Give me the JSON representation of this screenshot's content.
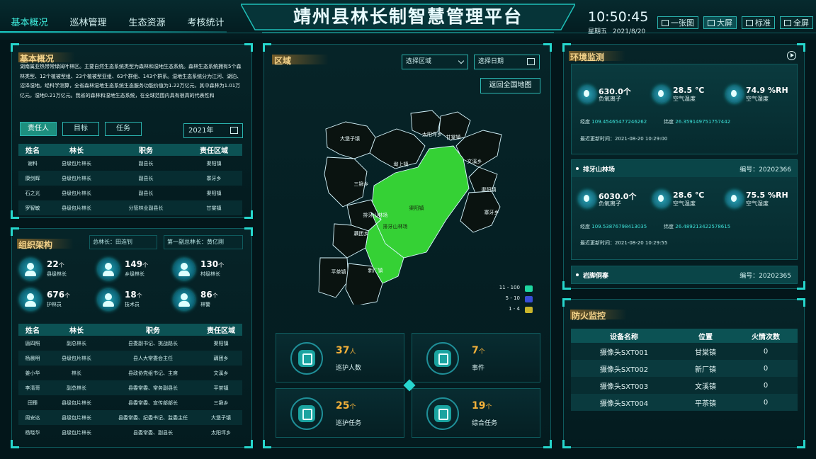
{
  "nav": [
    "基本概况",
    "巡林管理",
    "生态资源",
    "考核统计"
  ],
  "title": "靖州县林长制智慧管理平台",
  "clock": {
    "time": "10:50:45",
    "weekday": "星期五",
    "date": "2021/8/20"
  },
  "mode_buttons": [
    "一张图",
    "大屏",
    "标准",
    "全屏"
  ],
  "overview": {
    "title": "基本概况",
    "intro": "湖南属亚热带常绿阔叶林区。主要自然生态系统类型为森林和湿地生态系统。森林生态系统拥有5个森林类型、12个植被型组、23个植被型亚组、63个群组、143个群系。湿地生态系统分为江河、湖泊、沼泽湿地。经科学测算，全省森林湿地生态系统生态服务功能价值为1.22万亿元，其中森林为1.01万亿元，湿地0.21万亿元。我省的森林和湿地生态系统，在全球范围内具有很高的代表性和",
    "tabs": [
      "责任人",
      "目标",
      "任务"
    ],
    "year": "2021年",
    "headers": [
      "姓名",
      "林长",
      "职务",
      "责任区域"
    ],
    "rows": [
      [
        "谢科",
        "县级包片林长",
        "副县长",
        "渠阳镇"
      ],
      [
        "康剑辉",
        "县级包片林长",
        "副县长",
        "寨牙乡"
      ],
      [
        "石之光",
        "县级包片林长",
        "副县长",
        "渠阳镇"
      ],
      [
        "罗智敏",
        "县级包片林长",
        "分管林业副县长",
        "甘棠镇"
      ]
    ]
  },
  "org": {
    "title": "组织架构",
    "chief": "总林长：田连钊",
    "vice_chief": "第一副总林长：黄亿刚",
    "stats": [
      {
        "num": "22",
        "unit": "个",
        "label": "县级林长"
      },
      {
        "num": "149",
        "unit": "个",
        "label": "乡级林长"
      },
      {
        "num": "130",
        "unit": "个",
        "label": "村级林长"
      },
      {
        "num": "676",
        "unit": "个",
        "label": "护林员"
      },
      {
        "num": "18",
        "unit": "个",
        "label": "技术员"
      },
      {
        "num": "86",
        "unit": "个",
        "label": "林警"
      }
    ],
    "headers": [
      "姓名",
      "林长",
      "职务",
      "责任区域"
    ],
    "rows": [
      [
        "唐四照",
        "副总林长",
        "县委副书记、挑战路长",
        "渠阳镇"
      ],
      [
        "杨晨明",
        "县级包片林长",
        "县人大常委会主任",
        "藕团乡"
      ],
      [
        "姜小华",
        "林长",
        "县政协党组书记、主席",
        "文溪乡"
      ],
      [
        "李清哥",
        "副总林长",
        "县委常委、常务副县长",
        "平茶镇"
      ],
      [
        "田臻",
        "县级包片林长",
        "县委常委、宣传部部长",
        "三锹乡"
      ],
      [
        "周安达",
        "县级包片林长",
        "县委常委、纪委书记、监委主任",
        "大堡子镇"
      ],
      [
        "杨晓华",
        "县级包片林长",
        "县委常委、副县长",
        "太阳坪乡"
      ]
    ]
  },
  "map": {
    "title": "区域",
    "region_select": "选择区域",
    "date_select": "选择日期",
    "back_label": "返回全国地图",
    "regions": [
      {
        "name": "大堡子镇",
        "level": "low"
      },
      {
        "name": "太阳坪乡",
        "level": "low"
      },
      {
        "name": "甘棠镇",
        "level": "low"
      },
      {
        "name": "坳上镇",
        "level": "low"
      },
      {
        "name": "文溪乡",
        "level": "low"
      },
      {
        "name": "三锹乡",
        "level": "low"
      },
      {
        "name": "渠阳镇",
        "level": "high"
      },
      {
        "name": "渠阳镇",
        "level": "low"
      },
      {
        "name": "寨牙乡",
        "level": "low"
      },
      {
        "name": "排牙山林场",
        "level": "low"
      },
      {
        "name": "排牙山林场",
        "level": "high"
      },
      {
        "name": "藕团乡",
        "level": "low"
      },
      {
        "name": "平茶镇",
        "level": "low"
      },
      {
        "name": "新厂镇",
        "level": "low"
      }
    ],
    "legend": [
      {
        "label": "11 - 100",
        "color": "#1ed7a0"
      },
      {
        "label": "5 - 10",
        "color": "#3a4ed8"
      },
      {
        "label": "1 - 4",
        "color": "#c9b52b"
      }
    ],
    "colors": {
      "high": "#35d135",
      "low": "#0a1310",
      "border": "#d8f7ff"
    },
    "cards": [
      {
        "value": "37",
        "unit": "人",
        "label": "巡护人数",
        "icon": "patrol-person-icon"
      },
      {
        "value": "7",
        "unit": "个",
        "label": "事件",
        "icon": "event-image-icon"
      },
      {
        "value": "25",
        "unit": "个",
        "label": "巡护任务",
        "icon": "map-pin-icon"
      },
      {
        "value": "19",
        "unit": "个",
        "label": "综合任务",
        "icon": "clipboard-icon"
      }
    ]
  },
  "env": {
    "title": "环境监测",
    "stations": [
      {
        "name": "",
        "code": "",
        "anion": "630.0个",
        "anion_label": "负氧离子",
        "temp": "28.5 ℃",
        "temp_label": "空气温度",
        "humid": "74.9 %RH",
        "humid_label": "空气湿度",
        "lon_label": "经度",
        "lon": "109.45465477246262",
        "lat_label": "纬度",
        "lat": "26.359149751757442",
        "updated": "最近更新时间：2021-08-20 10:29:00"
      },
      {
        "name": "排牙山林场",
        "code": "编号：20202366",
        "anion": "6030.0个",
        "anion_label": "负氧离子",
        "temp": "28.6 ℃",
        "temp_label": "空气温度",
        "humid": "75.5 %RH",
        "humid_label": "空气湿度",
        "lon_label": "经度",
        "lon": "109.53876798413035",
        "lat_label": "纬度",
        "lat": "26.489213422578615",
        "updated": "最近更新时间：2021-08-20 10:29:55"
      },
      {
        "name": "岩脚侗寨",
        "code": "编号：20202365"
      }
    ]
  },
  "fire": {
    "title": "防火监控",
    "headers": [
      "设备名称",
      "位置",
      "火情次数"
    ],
    "rows": [
      [
        "摄像头SXT001",
        "甘棠镇",
        "0"
      ],
      [
        "摄像头SXT002",
        "新厂镇",
        "0"
      ],
      [
        "摄像头SXT003",
        "文溪镇",
        "0"
      ],
      [
        "摄像头SXT004",
        "平茶镇",
        "0"
      ]
    ]
  }
}
